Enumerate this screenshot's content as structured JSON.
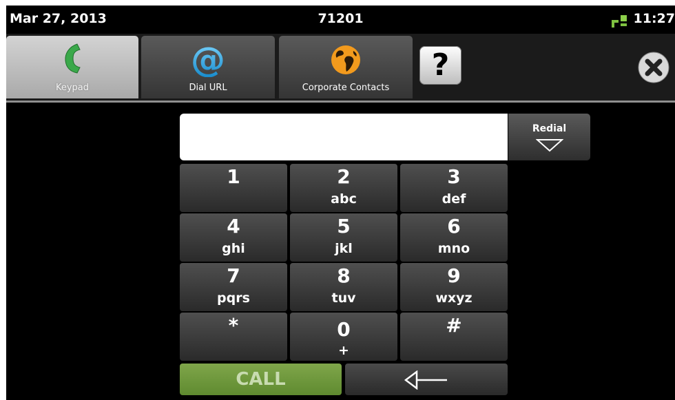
{
  "status_bar": {
    "date": "Mar 27, 2013",
    "extension": "71201",
    "time": "11:27",
    "network_icon": "network-status-icon",
    "network_color": "#7fc241"
  },
  "tabs": [
    {
      "label": "Keypad",
      "icon": "phone-handset-icon",
      "active": true
    },
    {
      "label": "Dial URL",
      "icon": "at-sign-icon",
      "active": false
    },
    {
      "label": "Corporate Contacts",
      "icon": "globe-icon",
      "active": false
    }
  ],
  "help": {
    "label": "?",
    "icon": "help-icon"
  },
  "close": {
    "icon": "close-icon"
  },
  "dial_input": {
    "value": "",
    "placeholder": ""
  },
  "redial": {
    "label": "Redial",
    "icon": "chevron-down-icon"
  },
  "keypad": [
    {
      "digit": "1",
      "letters": ""
    },
    {
      "digit": "2",
      "letters": "abc"
    },
    {
      "digit": "3",
      "letters": "def"
    },
    {
      "digit": "4",
      "letters": "ghi"
    },
    {
      "digit": "5",
      "letters": "jkl"
    },
    {
      "digit": "6",
      "letters": "mno"
    },
    {
      "digit": "7",
      "letters": "pqrs"
    },
    {
      "digit": "8",
      "letters": "tuv"
    },
    {
      "digit": "9",
      "letters": "wxyz"
    },
    {
      "digit": "*",
      "letters": ""
    },
    {
      "digit": "0",
      "letters": "+"
    },
    {
      "digit": "#",
      "letters": ""
    }
  ],
  "call": {
    "label": "CALL",
    "color": "#6f9a3c"
  },
  "backspace": {
    "icon": "backspace-arrow-icon"
  },
  "colors": {
    "accent_green": "#6f9a3c",
    "tab_active": "#c0c0c0",
    "background": "#000000"
  }
}
